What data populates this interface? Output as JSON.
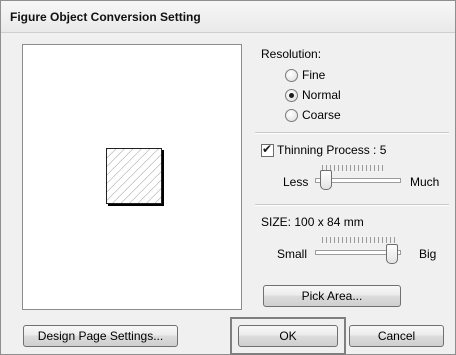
{
  "title": "Figure Object Conversion Setting",
  "resolution": {
    "label": "Resolution:",
    "options": [
      "Fine",
      "Normal",
      "Coarse"
    ],
    "selected": "Normal"
  },
  "thinning": {
    "label": "Thinning Process : 5",
    "checked": true,
    "value": 5,
    "min_label": "Less",
    "max_label": "Much"
  },
  "size": {
    "label": "SIZE:  100 x  84 mm",
    "min_label": "Small",
    "max_label": "Big",
    "level": 1.0
  },
  "buttons": {
    "pick_area": "Pick Area...",
    "design_page": "Design Page Settings...",
    "ok": "OK",
    "cancel": "Cancel"
  },
  "icons": [
    "radio-icon",
    "checkbox-icon",
    "slider-thumb-icon"
  ],
  "colors": {
    "dialog_bg": "#f0f0f0",
    "preview_bg": "#ffffff",
    "ok_highlight": "#7f7f7f"
  }
}
